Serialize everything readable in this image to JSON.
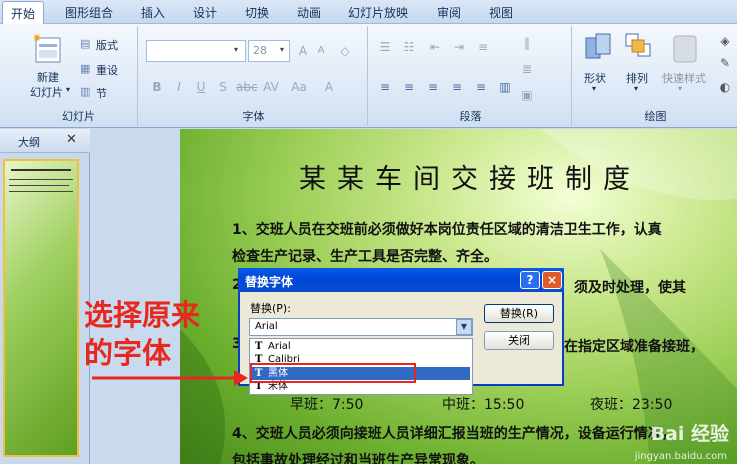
{
  "ribbon": {
    "tabs": [
      "开始",
      "图形组合",
      "插入",
      "设计",
      "切换",
      "动画",
      "幻灯片放映",
      "审阅",
      "视图"
    ],
    "slides_group": {
      "new_slide_line1": "新建",
      "new_slide_line2": "幻灯片",
      "layout": "版式",
      "reset": "重设",
      "section": "节",
      "label": "幻灯片"
    },
    "font_group": {
      "font_size": "28",
      "label": "字体"
    },
    "paragraph_group": {
      "label": "段落"
    },
    "drawing_group": {
      "shapes": "形状",
      "arrange": "排列",
      "quick_styles": "快速样式",
      "label": "绘图"
    }
  },
  "outline_panel": {
    "tab_label": "大纲"
  },
  "slide": {
    "title": "某某车间交接班制度",
    "lines": [
      "1、交班人员在交班前必须做好本岗位责任区域的清洁卫生工作，认真",
      "检查生产记录、生产工具是否完整、齐全。",
      "2",
      "须及时处理，使其",
      "3",
      "在指定区域准备接班，",
      "早班：7:50",
      "中班：15:50",
      "夜班：23:50",
      "4、交班人员必须向接班人员详细汇报当班的生产情况，设备运行情况，",
      "包括事故处理经过和当班生产异常现象。"
    ]
  },
  "dialog": {
    "title": "替换字体",
    "help": "?",
    "close": "×",
    "replace_label": "替换(P):",
    "current_value": "Arial",
    "replace_button": "替换(R)",
    "close_button": "关闭",
    "options": [
      "Arial",
      "Calibri",
      "黑体",
      "宋体"
    ]
  },
  "annotation": {
    "line1": "选择原来",
    "line2": "的字体",
    "color": "#e8281e"
  },
  "watermark": {
    "brand": "Bai 经验",
    "url": "jingyan.baidu.com"
  }
}
